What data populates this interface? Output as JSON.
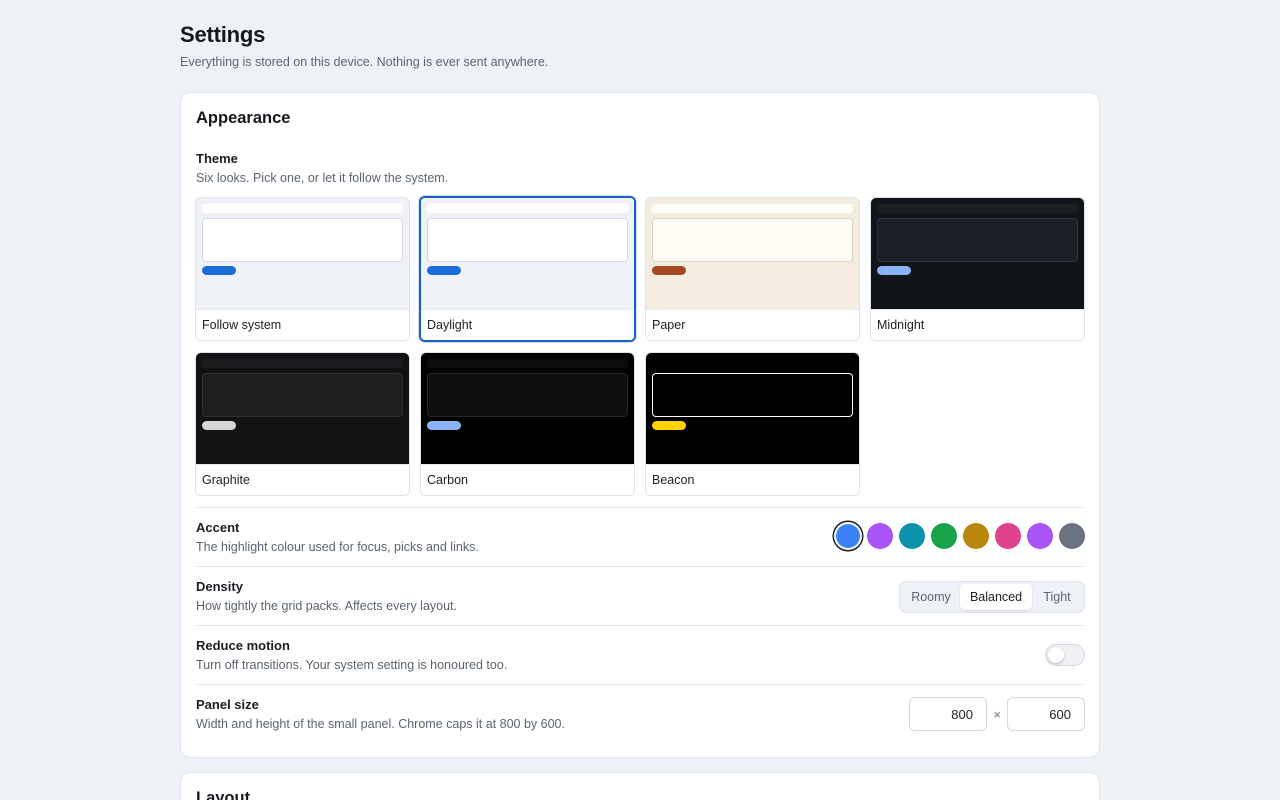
{
  "page": {
    "title": "Settings",
    "subtitle": "Everything is stored on this device. Nothing is ever sent anywhere."
  },
  "appearance": {
    "title": "Appearance",
    "theme": {
      "label": "Theme",
      "description": "Six looks. Pick one, or let it follow the system.",
      "selected": "Daylight",
      "tiles": [
        {
          "name": "Follow system",
          "bg": "#eef2f7",
          "bar": "#ffffff",
          "panel": "#ffffff",
          "panel_border": "#d4d9e1",
          "pill": "#1d6bd9"
        },
        {
          "name": "Daylight",
          "bg": "#eef2f7",
          "bar": "#ffffff",
          "panel": "#ffffff",
          "panel_border": "#d4d9e1",
          "pill": "#1d6bd9"
        },
        {
          "name": "Paper",
          "bg": "#f3ecdf",
          "bar": "#fffdf8",
          "panel": "#fffcf5",
          "panel_border": "#ddd5c4",
          "pill": "#a14a24"
        },
        {
          "name": "Midnight",
          "bg": "#111418",
          "bar": "#1b1f25",
          "panel": "#1c2027",
          "panel_border": "#2c313a",
          "pill": "#8cb4f5"
        },
        {
          "name": "Graphite",
          "bg": "#121214",
          "bar": "#1c1c1f",
          "panel": "#1e1e21",
          "panel_border": "#2e2e33",
          "pill": "#d6d6d8"
        },
        {
          "name": "Carbon",
          "bg": "#000000",
          "bar": "#0d0d0e",
          "panel": "#0f0f11",
          "panel_border": "#26262a",
          "pill": "#8cb4f5"
        },
        {
          "name": "Beacon",
          "bg": "#000000",
          "bar": "#000000",
          "panel": "#000000",
          "panel_border": "#ffffff",
          "pill": "#ffd200"
        }
      ]
    },
    "accent": {
      "label": "Accent",
      "description": "The highlight colour used for focus, picks and links.",
      "colors": [
        "#3b82f6",
        "#a855f7",
        "#0e91ab",
        "#16a34a",
        "#b8860b",
        "#e0418f",
        "#a855f7",
        "#6b7280"
      ],
      "selected_index": 0
    },
    "density": {
      "label": "Density",
      "description": "How tightly the grid packs. Affects every layout.",
      "options": [
        "Roomy",
        "Balanced",
        "Tight"
      ],
      "selected": "Balanced"
    },
    "reduce_motion": {
      "label": "Reduce motion",
      "description": "Turn off transitions. Your system setting is honoured too.",
      "enabled": false
    },
    "panel_size": {
      "label": "Panel size",
      "description": "Width and height of the small panel. Chrome caps it at 800 by 600.",
      "width": "800",
      "height": "600",
      "separator": "×"
    }
  },
  "layout": {
    "title": "Layout"
  }
}
